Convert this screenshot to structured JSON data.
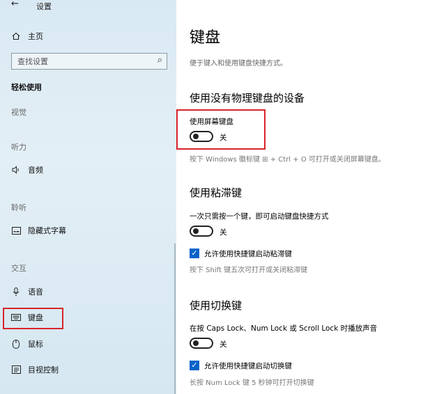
{
  "window": {
    "title": "设置"
  },
  "sidebar": {
    "home": "主页",
    "search_placeholder": "查找设置",
    "section": "轻松使用",
    "groups": {
      "vision": "视觉",
      "hearing": "听力",
      "interaction": "交互"
    },
    "items": {
      "audio": "音频",
      "captions": "隐藏式字幕",
      "speech": "语音",
      "keyboard": "键盘",
      "mouse": "鼠标",
      "eye_control": "目视控制"
    },
    "selected": "keyboard"
  },
  "main": {
    "title": "键盘",
    "description": "便于键入和使用键盘快捷方式。",
    "osk": {
      "heading": "使用没有物理键盘的设备",
      "label": "使用屏幕键盘",
      "state": "关",
      "hint": "按下 Windows 徽标键 ⊞ + Ctrl + O 可打开或关闭屏幕键盘。"
    },
    "sticky": {
      "heading": "使用粘滞键",
      "label": "一次只需按一个键，即可启动键盘快捷方式",
      "state": "关",
      "checkbox": "允许使用快捷键启动粘滞键",
      "hint": "按下 Shift 键五次可打开或关闭粘滞键"
    },
    "toggle_keys": {
      "heading": "使用切换键",
      "label": "在按 Caps Lock、Num Lock 或 Scroll Lock 时播放声音",
      "state": "关",
      "checkbox": "允许使用快捷键启动切换键",
      "hint": "长按 Num Lock 键 5 秒钟可打开切换键"
    }
  },
  "colors": {
    "highlight": "#d8242b",
    "accent": "#0a63c9"
  }
}
